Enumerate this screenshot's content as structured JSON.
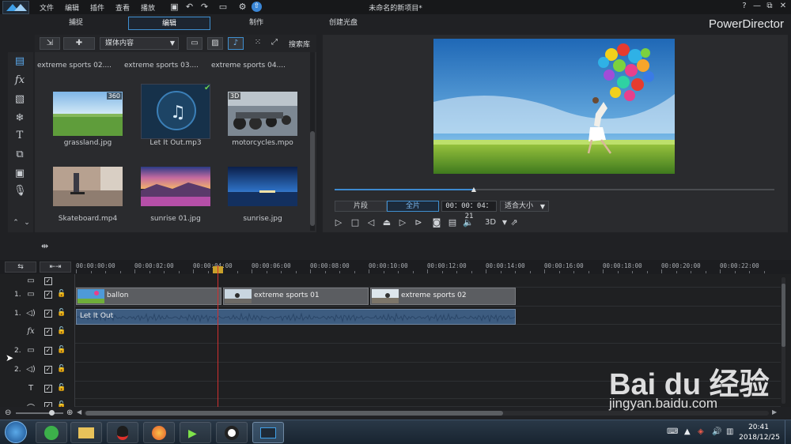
{
  "titlebar": {
    "menu": [
      "文件",
      "编辑",
      "插件",
      "查看",
      "播放"
    ],
    "title": "未命名的新项目*",
    "controls": [
      "?",
      "—",
      "⧉",
      "✕"
    ]
  },
  "modes": {
    "tabs": [
      "捕捉",
      "编辑",
      "制作",
      "创建光盘"
    ],
    "brand": "PowerDirector"
  },
  "library": {
    "dropdown": "媒体内容",
    "search": "搜索库",
    "items": [
      {
        "caption": "extreme sports 02...."
      },
      {
        "caption": "extreme sports 03...."
      },
      {
        "caption": "extreme sports 04...."
      },
      {
        "caption": "grassland.jpg",
        "badge": "360"
      },
      {
        "caption": "Let It Out.mp3"
      },
      {
        "caption": "motorcycles.mpo",
        "badge": "3D"
      },
      {
        "caption": "Skateboard.mp4"
      },
      {
        "caption": "sunrise 01.jpg"
      },
      {
        "caption": "sunrise.jpg"
      }
    ]
  },
  "preview": {
    "tab_clip": "片段",
    "tab_movie": "全片",
    "timecode": "00：00：04：21",
    "fit": "适合大小",
    "threed": "3D",
    "seek_position": 0.32
  },
  "timeline": {
    "ticks": [
      "00:00:00:00",
      "00:00:02:00",
      "00:00:04:00",
      "00:00:06:00",
      "00:00:08:00",
      "00:00:10:00",
      "00:00:12:00",
      "00:00:14:00",
      "00:00:16:00",
      "00:00:18:00",
      "00:00:20:00",
      "00:00:22:00"
    ],
    "tracks": [
      {
        "num": "",
        "icon": "video-track-icon"
      },
      {
        "num": "1.",
        "icon": "video-track-icon"
      },
      {
        "num": "1.",
        "icon": "audio-track-icon"
      },
      {
        "num": "",
        "icon": "fx-track-icon"
      },
      {
        "num": "2.",
        "icon": "video-track-icon"
      },
      {
        "num": "2.",
        "icon": "audio-track-icon"
      },
      {
        "num": "",
        "icon": "title-track-icon"
      },
      {
        "num": "",
        "icon": "voice-track-icon"
      }
    ],
    "video_clips": [
      "ballon",
      "extreme sports 01",
      "extreme sports 02"
    ],
    "audio_clip": "Let It Out"
  },
  "taskbar": {
    "time": "20:41",
    "date": "2018/12/25"
  },
  "watermark": {
    "brand": "Bai du 经验",
    "sub": "jingyan.baidu.com"
  }
}
